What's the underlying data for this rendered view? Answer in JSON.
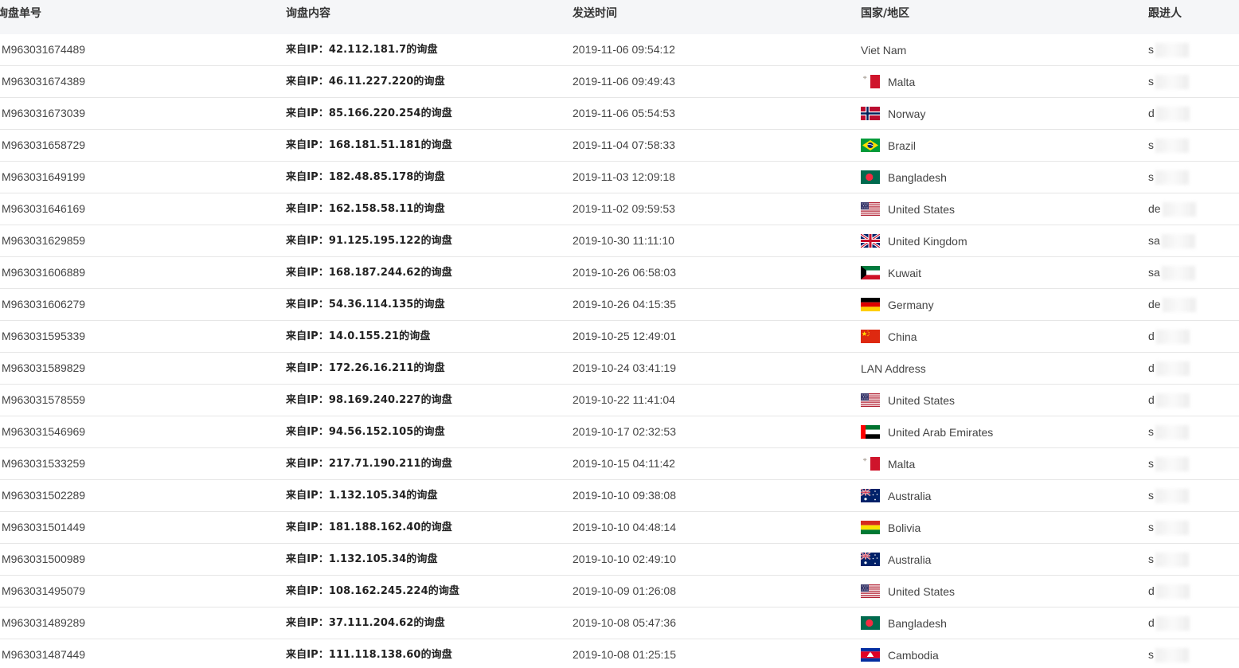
{
  "columns": {
    "id": "询盘单号",
    "content": "询盘内容",
    "time": "发送时间",
    "country": "国家/地区",
    "assignee": "跟进人"
  },
  "rows": [
    {
      "id": "M963031674489",
      "content": "来自IP：42.112.181.7的询盘",
      "time": "2019-11-06 09:54:12",
      "country": "Viet Nam",
      "flag": "",
      "assignee_prefix": "s"
    },
    {
      "id": "M963031674389",
      "content": "来自IP：46.11.227.220的询盘",
      "time": "2019-11-06 09:49:43",
      "country": "Malta",
      "flag": "mt",
      "assignee_prefix": "s"
    },
    {
      "id": "M963031673039",
      "content": "来自IP：85.166.220.254的询盘",
      "time": "2019-11-06 05:54:53",
      "country": "Norway",
      "flag": "no",
      "assignee_prefix": "d"
    },
    {
      "id": "M963031658729",
      "content": "来自IP：168.181.51.181的询盘",
      "time": "2019-11-04 07:58:33",
      "country": "Brazil",
      "flag": "br",
      "assignee_prefix": "s"
    },
    {
      "id": "M963031649199",
      "content": "来自IP：182.48.85.178的询盘",
      "time": "2019-11-03 12:09:18",
      "country": "Bangladesh",
      "flag": "bd",
      "assignee_prefix": "s"
    },
    {
      "id": "M963031646169",
      "content": "来自IP：162.158.58.11的询盘",
      "time": "2019-11-02 09:59:53",
      "country": "United States",
      "flag": "us",
      "assignee_prefix": "de"
    },
    {
      "id": "M963031629859",
      "content": "来自IP：91.125.195.122的询盘",
      "time": "2019-10-30 11:11:10",
      "country": "United Kingdom",
      "flag": "gb",
      "assignee_prefix": "sa"
    },
    {
      "id": "M963031606889",
      "content": "来自IP：168.187.244.62的询盘",
      "time": "2019-10-26 06:58:03",
      "country": "Kuwait",
      "flag": "kw",
      "assignee_prefix": "sa"
    },
    {
      "id": "M963031606279",
      "content": "来自IP：54.36.114.135的询盘",
      "time": "2019-10-26 04:15:35",
      "country": "Germany",
      "flag": "de",
      "assignee_prefix": "de"
    },
    {
      "id": "M963031595339",
      "content": "来自IP：14.0.155.21的询盘",
      "time": "2019-10-25 12:49:01",
      "country": "China",
      "flag": "cn",
      "assignee_prefix": "d"
    },
    {
      "id": "M963031589829",
      "content": "来自IP：172.26.16.211的询盘",
      "time": "2019-10-24 03:41:19",
      "country": "LAN Address",
      "flag": "",
      "assignee_prefix": "d"
    },
    {
      "id": "M963031578559",
      "content": "来自IP：98.169.240.227的询盘",
      "time": "2019-10-22 11:41:04",
      "country": "United States",
      "flag": "us",
      "assignee_prefix": "d"
    },
    {
      "id": "M963031546969",
      "content": "来自IP：94.56.152.105的询盘",
      "time": "2019-10-17 02:32:53",
      "country": "United Arab Emirates",
      "flag": "ae",
      "assignee_prefix": "s"
    },
    {
      "id": "M963031533259",
      "content": "来自IP：217.71.190.211的询盘",
      "time": "2019-10-15 04:11:42",
      "country": "Malta",
      "flag": "mt",
      "assignee_prefix": "s"
    },
    {
      "id": "M963031502289",
      "content": "来自IP：1.132.105.34的询盘",
      "time": "2019-10-10 09:38:08",
      "country": "Australia",
      "flag": "au",
      "assignee_prefix": "s"
    },
    {
      "id": "M963031501449",
      "content": "来自IP：181.188.162.40的询盘",
      "time": "2019-10-10 04:48:14",
      "country": "Bolivia",
      "flag": "bo",
      "assignee_prefix": "s"
    },
    {
      "id": "M963031500989",
      "content": "来自IP：1.132.105.34的询盘",
      "time": "2019-10-10 02:49:10",
      "country": "Australia",
      "flag": "au",
      "assignee_prefix": "s"
    },
    {
      "id": "M963031495079",
      "content": "来自IP：108.162.245.224的询盘",
      "time": "2019-10-09 01:26:08",
      "country": "United States",
      "flag": "us",
      "assignee_prefix": "d"
    },
    {
      "id": "M963031489289",
      "content": "来自IP：37.111.204.62的询盘",
      "time": "2019-10-08 05:47:36",
      "country": "Bangladesh",
      "flag": "bd",
      "assignee_prefix": "d"
    },
    {
      "id": "M963031487449",
      "content": "来自IP：111.118.138.60的询盘",
      "time": "2019-10-08 01:25:15",
      "country": "Cambodia",
      "flag": "kh",
      "assignee_prefix": "s"
    }
  ]
}
